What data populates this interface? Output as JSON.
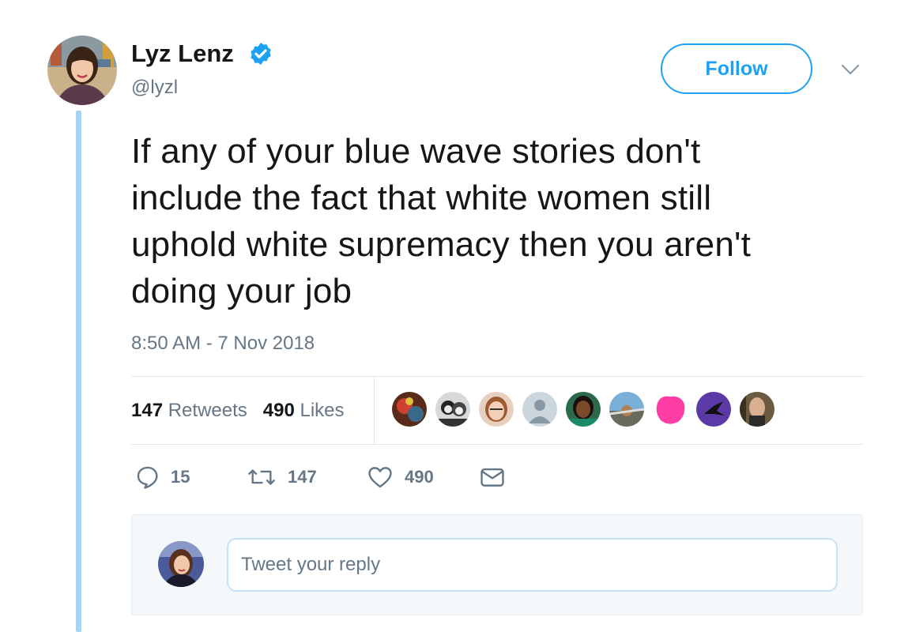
{
  "author": {
    "name": "Lyz Lenz",
    "handle": "@lyzl",
    "verified": true
  },
  "follow_label": "Follow",
  "tweet": {
    "text_lines": [
      "If any of your blue wave stories don't",
      "include the fact that white women still",
      "uphold white supremacy then you aren't",
      "doing your job"
    ],
    "timestamp": "8:50 AM - 7 Nov 2018"
  },
  "stats": {
    "retweets_count": "147",
    "retweets_label": "Retweets",
    "likes_count": "490",
    "likes_label": "Likes"
  },
  "actions": {
    "replies": "15",
    "retweets": "147",
    "likes": "490"
  },
  "reply": {
    "placeholder": "Tweet your reply"
  },
  "colors": {
    "accent": "#1da1f2",
    "thread_line": "#a6d4f2",
    "secondary_text": "#657786",
    "divider": "#e1e8ed"
  },
  "icons": [
    "verified-badge-icon",
    "chevron-down-icon",
    "reply-icon",
    "retweet-icon",
    "heart-icon",
    "direct-message-icon"
  ]
}
